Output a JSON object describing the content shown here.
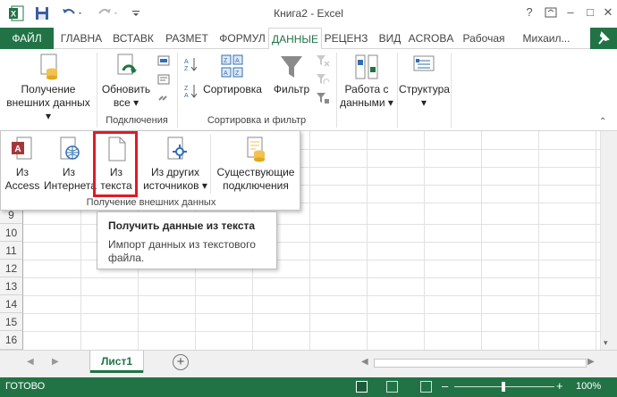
{
  "window": {
    "title": "Книга2 - Excel"
  },
  "tabs": {
    "file": "ФАЙЛ",
    "items": [
      "ГЛАВНА",
      "ВСТАВК",
      "РАЗМЕТ",
      "ФОРМУЛ",
      "ДАННЫЕ",
      "РЕЦЕНЗ",
      "ВИД",
      "ACROBA",
      "Рабочая"
    ],
    "user": "Михаил..."
  },
  "ribbon": {
    "get_external": {
      "line1": "Получение",
      "line2": "внешних данных ▾"
    },
    "refresh": {
      "line1": "Обновить",
      "line2": "все ▾"
    },
    "connections_label": "Подключения",
    "sort": "Сортировка",
    "filter": "Фильтр",
    "sort_filter_label": "Сортировка и фильтр",
    "data_tools": {
      "line1": "Работа с",
      "line2": "данными ▾"
    },
    "outline": {
      "line1": "Структура",
      "line2": "▾"
    }
  },
  "dropdown": {
    "items": [
      {
        "line1": "Из",
        "line2": "Access"
      },
      {
        "line1": "Из",
        "line2": "Интернета"
      },
      {
        "line1": "Из",
        "line2": "текста"
      },
      {
        "line1": "Из других",
        "line2": "источников ▾"
      },
      {
        "line1": "Существующие",
        "line2": "подключения"
      }
    ],
    "group_label": "Получение внешних данных"
  },
  "tooltip": {
    "title": "Получить данные из текста",
    "description": "Импорт данных из текстового файла."
  },
  "rows": [
    "9",
    "10",
    "11",
    "12",
    "13",
    "14",
    "15",
    "16"
  ],
  "sheet_tabs": [
    "Лист1"
  ],
  "status": {
    "ready": "ГОТОВО",
    "zoom": "100%"
  },
  "colors": {
    "accent": "#217346",
    "selection": "#e01b24"
  }
}
